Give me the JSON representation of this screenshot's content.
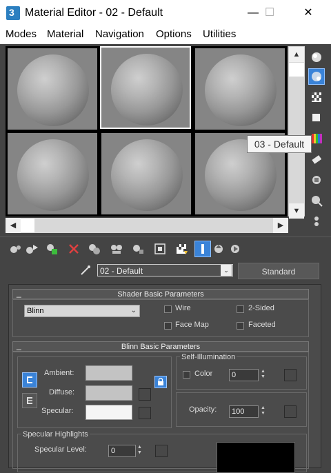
{
  "window": {
    "title": "Material Editor - 02 - Default",
    "minimize": "—",
    "maximize": "☐",
    "close": "✕"
  },
  "menu": [
    "Modes",
    "Material",
    "Navigation",
    "Options",
    "Utilities"
  ],
  "tooltip": "03 - Default",
  "material": {
    "name": "02 - Default",
    "type": "Standard"
  },
  "shader_basic": {
    "header": "Shader Basic Parameters",
    "shader": "Blinn",
    "wire": "Wire",
    "two_sided": "2-Sided",
    "face_map": "Face Map",
    "faceted": "Faceted"
  },
  "blinn_basic": {
    "header": "Blinn Basic Parameters",
    "ambient": "Ambient:",
    "diffuse": "Diffuse:",
    "specular": "Specular:",
    "self_illum_title": "Self-Illumination",
    "color": "Color",
    "self_illum_value": "0",
    "opacity_label": "Opacity:",
    "opacity_value": "100"
  },
  "specular_highlights": {
    "title": "Specular Highlights",
    "level_label": "Specular Level:",
    "level_value": "0"
  },
  "colors": {
    "ambient": "#c3c3c3",
    "diffuse": "#c3c3c3",
    "specular": "#f5f5f5",
    "accent": "#3a83d8"
  }
}
